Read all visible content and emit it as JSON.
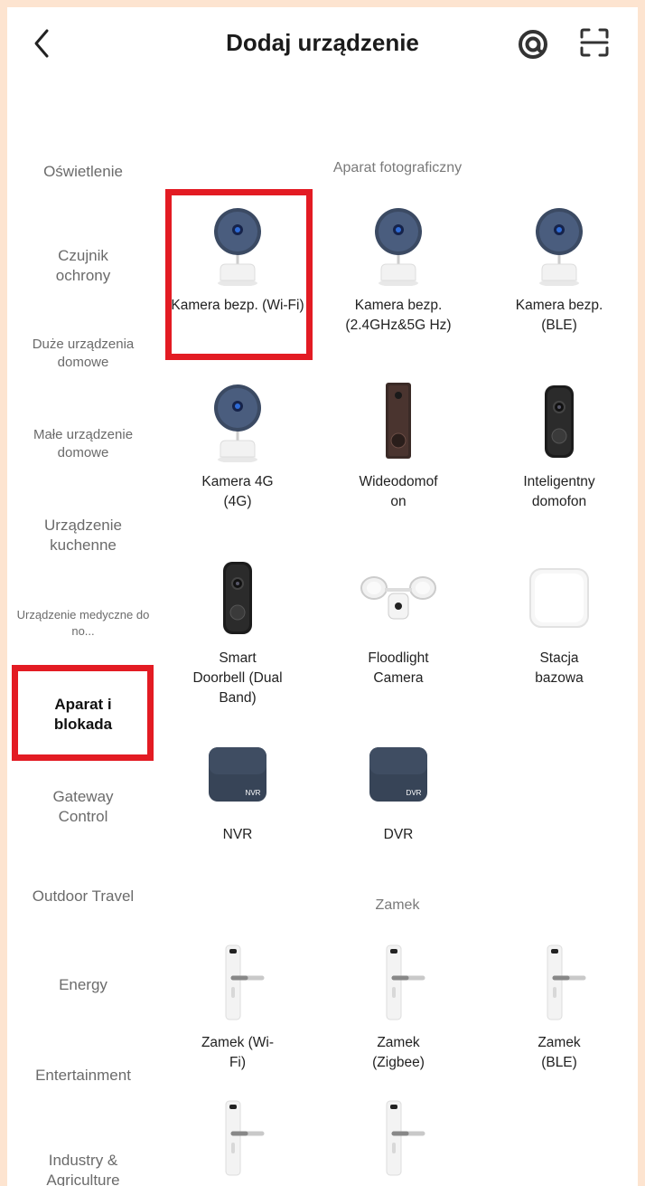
{
  "header": {
    "title": "Dodaj urządzenie"
  },
  "sidebar": {
    "items": [
      {
        "label": "Oświetlenie"
      },
      {
        "label": "Czujnik ochrony"
      },
      {
        "label": "Duże urządzenia domowe"
      },
      {
        "label": "Małe urządzenie domowe"
      },
      {
        "label": "Urządzenie kuchenne"
      },
      {
        "label": "Urządzenie medyczne do no..."
      },
      {
        "label": "Aparat i blokada"
      },
      {
        "label": "Gateway Control"
      },
      {
        "label": "Outdoor Travel"
      },
      {
        "label": "Energy"
      },
      {
        "label": "Entertainment"
      },
      {
        "label": "Industry & Agriculture"
      }
    ],
    "active_index": 6
  },
  "sections": [
    {
      "title": "Aparat fotograficzny",
      "devices": [
        {
          "label": "Kamera bezp. (Wi-Fi)",
          "icon": "security-camera-icon"
        },
        {
          "label": "Kamera bezp. (2.4GHz&5G Hz)",
          "icon": "security-camera-icon"
        },
        {
          "label": "Kamera bezp. (BLE)",
          "icon": "security-camera-icon"
        },
        {
          "label": "Kamera 4G (4G)",
          "icon": "security-camera-icon"
        },
        {
          "label": "Wideodomof on",
          "icon": "video-intercom-icon"
        },
        {
          "label": "Inteligentny domofon",
          "icon": "smart-doorbell-icon"
        },
        {
          "label": "Smart Doorbell (Dual Band)",
          "icon": "smart-doorbell-icon"
        },
        {
          "label": "Floodlight Camera",
          "icon": "floodlight-camera-icon"
        },
        {
          "label": "Stacja bazowa",
          "icon": "base-station-icon"
        },
        {
          "label": "NVR",
          "icon": "nvr-box-icon",
          "badge": "NVR"
        },
        {
          "label": "DVR",
          "icon": "dvr-box-icon",
          "badge": "DVR"
        }
      ]
    },
    {
      "title": "Zamek",
      "devices": [
        {
          "label": "Zamek (Wi-Fi)",
          "icon": "door-lock-icon"
        },
        {
          "label": "Zamek (Zigbee)",
          "icon": "door-lock-icon"
        },
        {
          "label": "Zamek (BLE)",
          "icon": "door-lock-icon"
        },
        {
          "label": "",
          "icon": "door-lock-icon"
        },
        {
          "label": "",
          "icon": "door-lock-icon"
        }
      ]
    }
  ],
  "colors": {
    "highlight": "#e31b23",
    "background": "#ffffff",
    "page_border": "#fde4d0"
  }
}
